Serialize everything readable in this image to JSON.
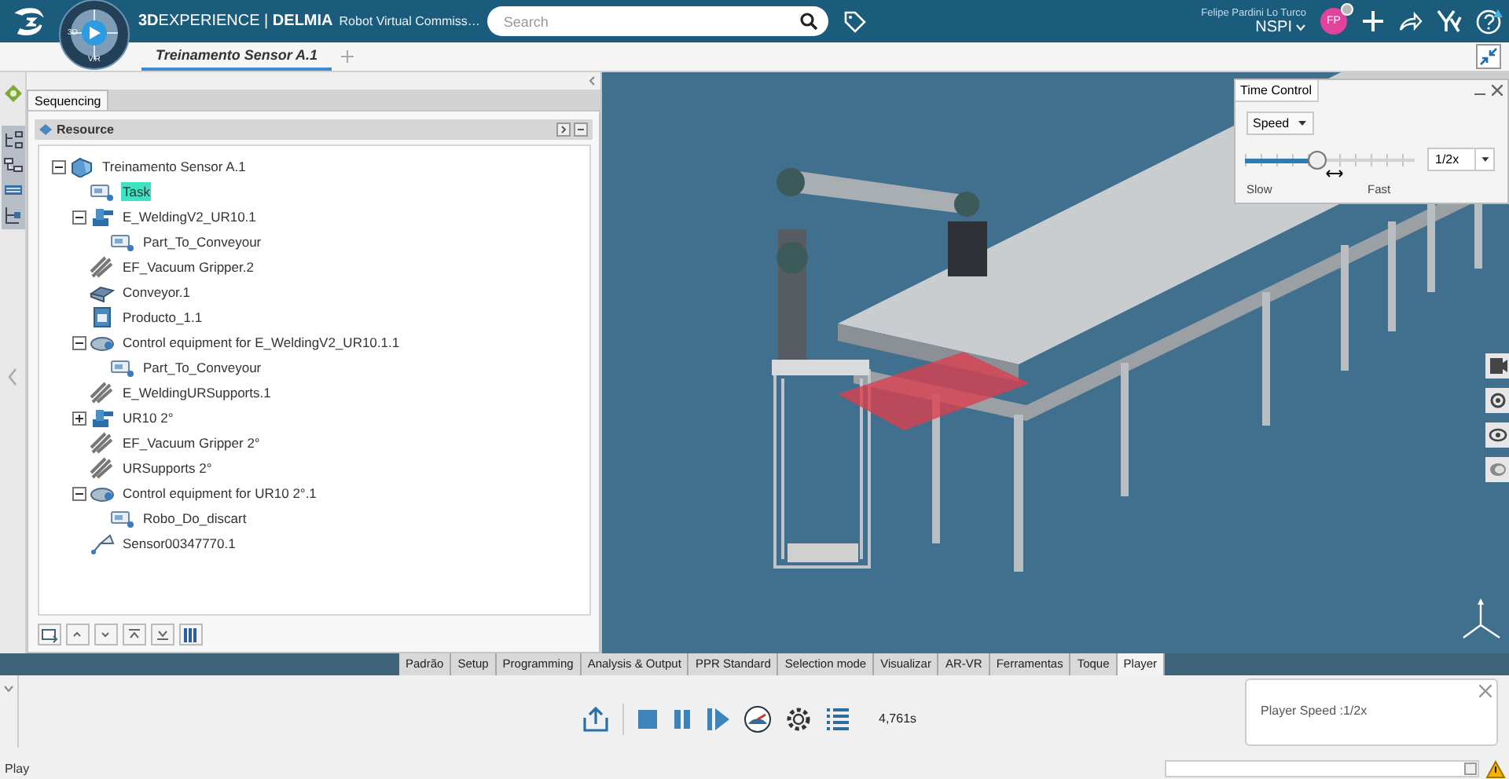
{
  "header": {
    "brand": "**3D**EXPERIENCE | **DELMIA**",
    "app_name": "Robot Virtual Commiss…",
    "compass_labels": [
      "3D",
      "V.R"
    ],
    "search": {
      "placeholder": "Search"
    },
    "user_name": "Felipe Pardini Lo Turco",
    "tenant": "NSPI",
    "avatar_initials": "FP"
  },
  "tabs": [
    {
      "label": "Treinamento Sensor A.1",
      "selected": true
    }
  ],
  "panel": {
    "tab": "Sequencing",
    "section": "Resource",
    "tree": [
      {
        "label": "Treinamento Sensor A.1",
        "kind": "product",
        "selected": false,
        "expanded": true,
        "children": [
          {
            "label": "Task",
            "kind": "task",
            "selected": true
          },
          {
            "label": "E_WeldingV2_UR10.1",
            "kind": "robot",
            "selected": false,
            "expanded": true,
            "children": [
              {
                "label": "Part_To_Conveyour",
                "kind": "task",
                "selected": false
              }
            ]
          },
          {
            "label": "EF_Vacuum Gripper.2",
            "kind": "tool",
            "selected": false
          },
          {
            "label": "Conveyor.1",
            "kind": "conveyor",
            "selected": false
          },
          {
            "label": "Producto_1.1",
            "kind": "part",
            "selected": false
          },
          {
            "label": "Control equipment for E_WeldingV2_UR10.1.1",
            "kind": "controller",
            "selected": false,
            "expanded": true,
            "children": [
              {
                "label": "Part_To_Conveyour",
                "kind": "task",
                "selected": false
              }
            ]
          },
          {
            "label": "E_WeldingURSupports.1",
            "kind": "tool",
            "selected": false
          },
          {
            "label": "UR10 2°",
            "kind": "robot",
            "selected": false,
            "expanded": false
          },
          {
            "label": "EF_Vacuum Gripper 2°",
            "kind": "tool",
            "selected": false
          },
          {
            "label": "URSupports 2°",
            "kind": "tool",
            "selected": false
          },
          {
            "label": "Control equipment for UR10 2°.1",
            "kind": "controller",
            "selected": false,
            "expanded": true,
            "children": [
              {
                "label": "Robo_Do_discart",
                "kind": "task",
                "selected": false
              }
            ]
          },
          {
            "label": "Sensor00347770.1",
            "kind": "sensor",
            "selected": false
          }
        ]
      }
    ]
  },
  "time_control": {
    "title": "Time Control",
    "mode": "Speed",
    "level": 0.43,
    "value": "1/2x",
    "min_label": "Slow",
    "max_label": "Fast"
  },
  "action_tabs": [
    {
      "label": "Padrão",
      "selected": false
    },
    {
      "label": "Setup",
      "selected": false
    },
    {
      "label": "Programming",
      "selected": false
    },
    {
      "label": "Analysis & Output",
      "selected": false
    },
    {
      "label": "PPR Standard",
      "selected": false
    },
    {
      "label": "Selection mode",
      "selected": false
    },
    {
      "label": "Visualizar",
      "selected": false
    },
    {
      "label": "AR-VR",
      "selected": false
    },
    {
      "label": "Ferramentas",
      "selected": false
    },
    {
      "label": "Toque",
      "selected": false
    },
    {
      "label": "Player",
      "selected": true
    }
  ],
  "player": {
    "time": "4,761s"
  },
  "notification": {
    "message": "Player Speed :1/2x"
  },
  "status_bar": {
    "text": "Play"
  }
}
